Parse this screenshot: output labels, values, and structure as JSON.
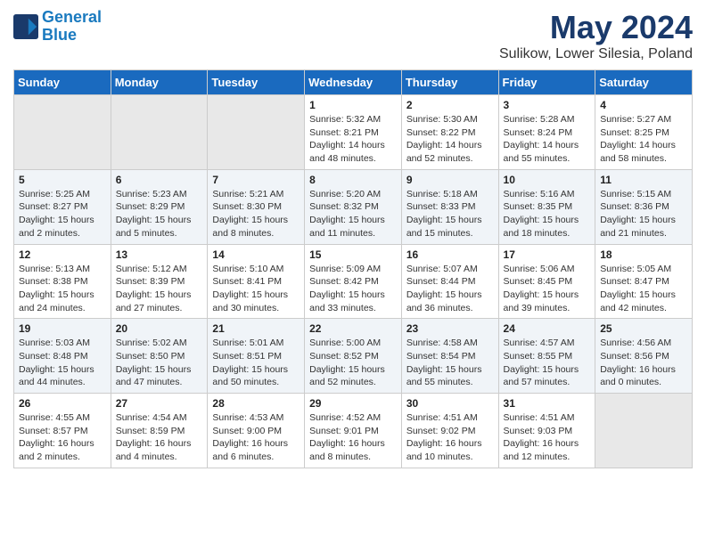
{
  "header": {
    "logo_line1": "General",
    "logo_line2": "Blue",
    "title": "May 2024",
    "subtitle": "Sulikow, Lower Silesia, Poland"
  },
  "weekdays": [
    "Sunday",
    "Monday",
    "Tuesday",
    "Wednesday",
    "Thursday",
    "Friday",
    "Saturday"
  ],
  "weeks": [
    [
      {
        "day": "",
        "info": ""
      },
      {
        "day": "",
        "info": ""
      },
      {
        "day": "",
        "info": ""
      },
      {
        "day": "1",
        "info": "Sunrise: 5:32 AM\nSunset: 8:21 PM\nDaylight: 14 hours\nand 48 minutes."
      },
      {
        "day": "2",
        "info": "Sunrise: 5:30 AM\nSunset: 8:22 PM\nDaylight: 14 hours\nand 52 minutes."
      },
      {
        "day": "3",
        "info": "Sunrise: 5:28 AM\nSunset: 8:24 PM\nDaylight: 14 hours\nand 55 minutes."
      },
      {
        "day": "4",
        "info": "Sunrise: 5:27 AM\nSunset: 8:25 PM\nDaylight: 14 hours\nand 58 minutes."
      }
    ],
    [
      {
        "day": "5",
        "info": "Sunrise: 5:25 AM\nSunset: 8:27 PM\nDaylight: 15 hours\nand 2 minutes."
      },
      {
        "day": "6",
        "info": "Sunrise: 5:23 AM\nSunset: 8:29 PM\nDaylight: 15 hours\nand 5 minutes."
      },
      {
        "day": "7",
        "info": "Sunrise: 5:21 AM\nSunset: 8:30 PM\nDaylight: 15 hours\nand 8 minutes."
      },
      {
        "day": "8",
        "info": "Sunrise: 5:20 AM\nSunset: 8:32 PM\nDaylight: 15 hours\nand 11 minutes."
      },
      {
        "day": "9",
        "info": "Sunrise: 5:18 AM\nSunset: 8:33 PM\nDaylight: 15 hours\nand 15 minutes."
      },
      {
        "day": "10",
        "info": "Sunrise: 5:16 AM\nSunset: 8:35 PM\nDaylight: 15 hours\nand 18 minutes."
      },
      {
        "day": "11",
        "info": "Sunrise: 5:15 AM\nSunset: 8:36 PM\nDaylight: 15 hours\nand 21 minutes."
      }
    ],
    [
      {
        "day": "12",
        "info": "Sunrise: 5:13 AM\nSunset: 8:38 PM\nDaylight: 15 hours\nand 24 minutes."
      },
      {
        "day": "13",
        "info": "Sunrise: 5:12 AM\nSunset: 8:39 PM\nDaylight: 15 hours\nand 27 minutes."
      },
      {
        "day": "14",
        "info": "Sunrise: 5:10 AM\nSunset: 8:41 PM\nDaylight: 15 hours\nand 30 minutes."
      },
      {
        "day": "15",
        "info": "Sunrise: 5:09 AM\nSunset: 8:42 PM\nDaylight: 15 hours\nand 33 minutes."
      },
      {
        "day": "16",
        "info": "Sunrise: 5:07 AM\nSunset: 8:44 PM\nDaylight: 15 hours\nand 36 minutes."
      },
      {
        "day": "17",
        "info": "Sunrise: 5:06 AM\nSunset: 8:45 PM\nDaylight: 15 hours\nand 39 minutes."
      },
      {
        "day": "18",
        "info": "Sunrise: 5:05 AM\nSunset: 8:47 PM\nDaylight: 15 hours\nand 42 minutes."
      }
    ],
    [
      {
        "day": "19",
        "info": "Sunrise: 5:03 AM\nSunset: 8:48 PM\nDaylight: 15 hours\nand 44 minutes."
      },
      {
        "day": "20",
        "info": "Sunrise: 5:02 AM\nSunset: 8:50 PM\nDaylight: 15 hours\nand 47 minutes."
      },
      {
        "day": "21",
        "info": "Sunrise: 5:01 AM\nSunset: 8:51 PM\nDaylight: 15 hours\nand 50 minutes."
      },
      {
        "day": "22",
        "info": "Sunrise: 5:00 AM\nSunset: 8:52 PM\nDaylight: 15 hours\nand 52 minutes."
      },
      {
        "day": "23",
        "info": "Sunrise: 4:58 AM\nSunset: 8:54 PM\nDaylight: 15 hours\nand 55 minutes."
      },
      {
        "day": "24",
        "info": "Sunrise: 4:57 AM\nSunset: 8:55 PM\nDaylight: 15 hours\nand 57 minutes."
      },
      {
        "day": "25",
        "info": "Sunrise: 4:56 AM\nSunset: 8:56 PM\nDaylight: 16 hours\nand 0 minutes."
      }
    ],
    [
      {
        "day": "26",
        "info": "Sunrise: 4:55 AM\nSunset: 8:57 PM\nDaylight: 16 hours\nand 2 minutes."
      },
      {
        "day": "27",
        "info": "Sunrise: 4:54 AM\nSunset: 8:59 PM\nDaylight: 16 hours\nand 4 minutes."
      },
      {
        "day": "28",
        "info": "Sunrise: 4:53 AM\nSunset: 9:00 PM\nDaylight: 16 hours\nand 6 minutes."
      },
      {
        "day": "29",
        "info": "Sunrise: 4:52 AM\nSunset: 9:01 PM\nDaylight: 16 hours\nand 8 minutes."
      },
      {
        "day": "30",
        "info": "Sunrise: 4:51 AM\nSunset: 9:02 PM\nDaylight: 16 hours\nand 10 minutes."
      },
      {
        "day": "31",
        "info": "Sunrise: 4:51 AM\nSunset: 9:03 PM\nDaylight: 16 hours\nand 12 minutes."
      },
      {
        "day": "",
        "info": ""
      }
    ]
  ]
}
